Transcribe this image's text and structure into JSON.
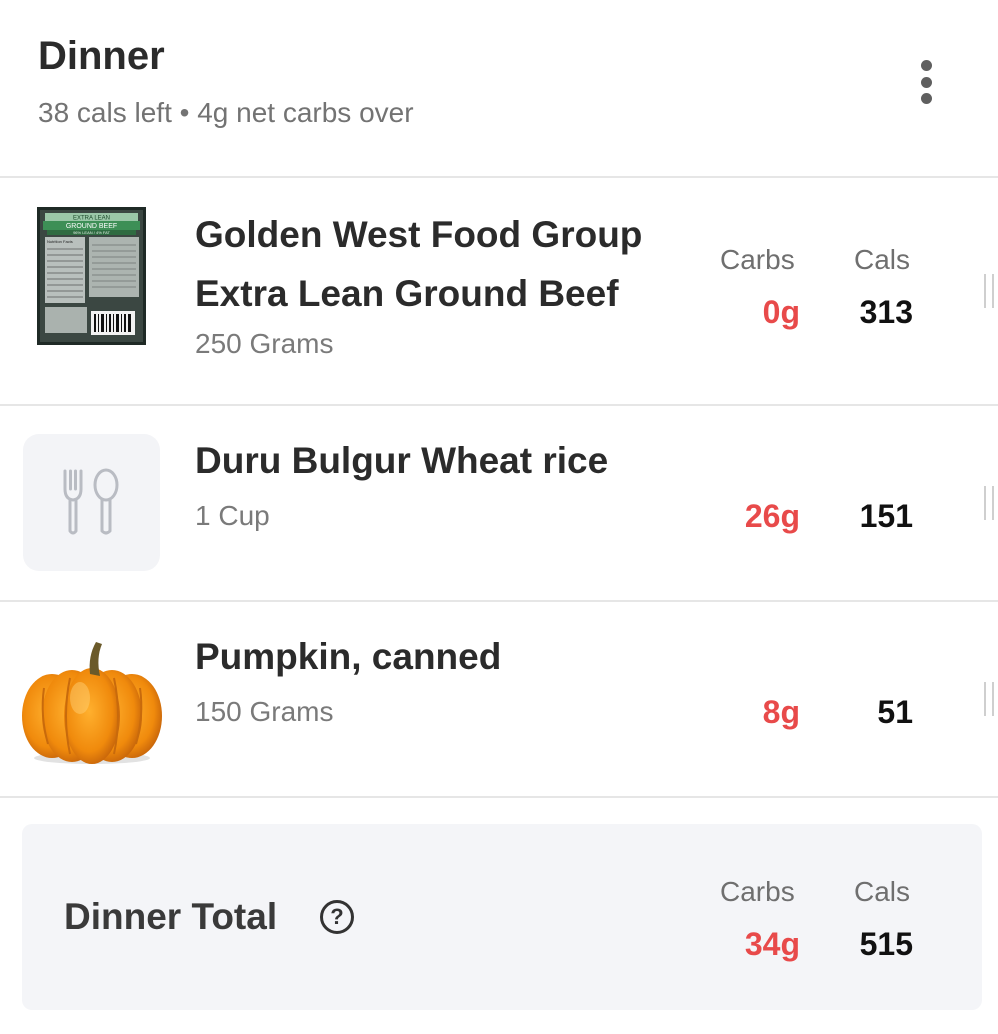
{
  "meal": {
    "title": "Dinner",
    "subtitle": "38 cals left • 4g net carbs over"
  },
  "columns": {
    "carbs": "Carbs",
    "cals": "Cals"
  },
  "items": [
    {
      "name_line1": "Golden West Food Group",
      "name_line2": "Extra Lean Ground Beef",
      "qty": "250 Grams",
      "carbs": "0g",
      "cals": "313",
      "thumb": "ground-beef-package",
      "package_text": [
        "EXTRA LEAN",
        "GROUND BEEF",
        "96% LEAN / 4% FAT",
        "Nutrition Facts"
      ]
    },
    {
      "name_line1": "Duru Bulgur Wheat rice",
      "qty": "1 Cup",
      "carbs": "26g",
      "cals": "151",
      "thumb": "fork-spoon-icon"
    },
    {
      "name_line1": "Pumpkin, canned",
      "qty": "150 Grams",
      "carbs": "8g",
      "cals": "51",
      "thumb": "pumpkin"
    }
  ],
  "total": {
    "label": "Dinner Total",
    "help": "?",
    "carbs": "34g",
    "cals": "515"
  },
  "colors": {
    "carbs_red": "#e84a4a",
    "divider": "#e6e6e6",
    "total_bg": "#f4f5f8"
  }
}
